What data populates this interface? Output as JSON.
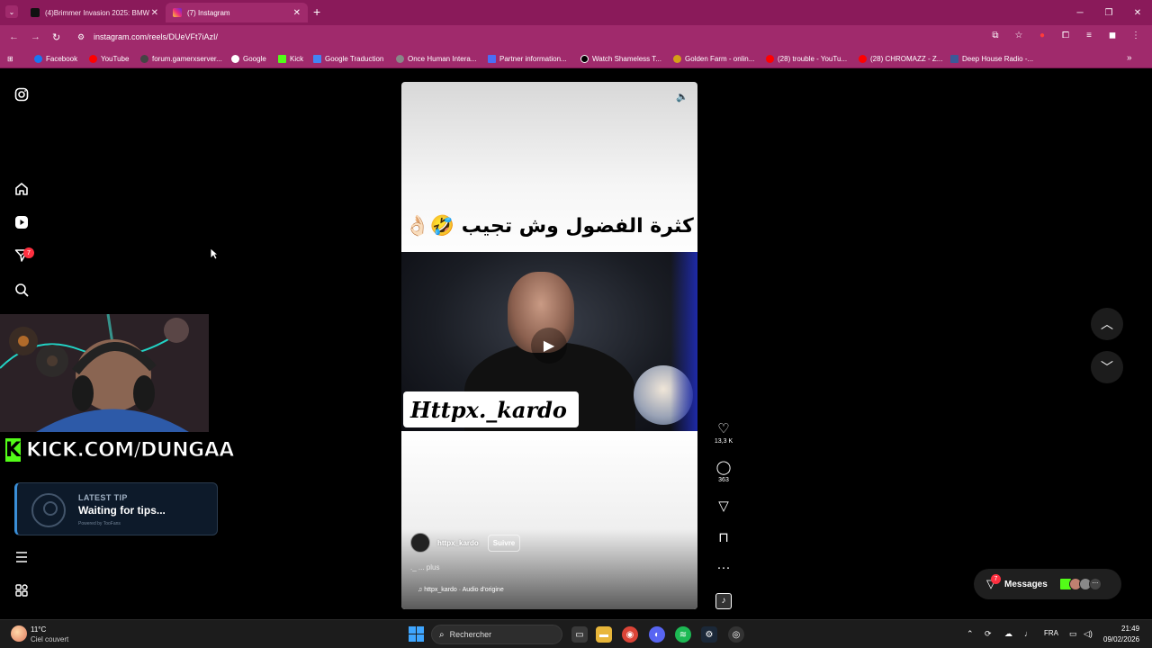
{
  "browser": {
    "tabs": [
      {
        "label": "(4)Brimmer Invasion 2025: BMW",
        "active": false
      },
      {
        "label": "(7) Instagram",
        "active": true
      }
    ],
    "url": "instagram.com/reels/DUeVFt7iAzI/",
    "bookmarks": [
      {
        "label": "Facebook",
        "color": "#1877f2"
      },
      {
        "label": "YouTube",
        "color": "#ff0000"
      },
      {
        "label": "forum.gamerxserver...",
        "color": "#444444"
      },
      {
        "label": "Google",
        "color": "#ffffff"
      },
      {
        "label": "Kick",
        "color": "#53fc18"
      },
      {
        "label": "Google Traduction",
        "color": "#4285f4"
      },
      {
        "label": "Once Human Intera...",
        "color": "#888888"
      },
      {
        "label": "Partner information...",
        "color": "#4b6ef5"
      },
      {
        "label": "Watch Shameless T...",
        "color": "#000000"
      },
      {
        "label": "Golden Farm - onlin...",
        "color": "#d4a017"
      },
      {
        "label": "(28) trouble - YouTu...",
        "color": "#ff0000"
      },
      {
        "label": "(28) CHROMAZZ - Z...",
        "color": "#ff0000"
      },
      {
        "label": "Deep House Radio -...",
        "color": "#3b5998"
      }
    ]
  },
  "sidebar": {
    "notification_count": "7"
  },
  "stream_overlay": {
    "kick_url": "KICK.COM/DUNGAA",
    "kick_logo_letter": "K",
    "tip_label": "LATEST TIP",
    "tip_text": "Waiting for tips...",
    "tip_powered": "Powered by TooFans"
  },
  "reel": {
    "caption_overlay": "كثرة الفضول وش تجيب 🤣👌🏻",
    "watermark": "Httpx._kardo",
    "author": "httpx_kardo",
    "follow_label": "Suivre",
    "caption": "._ ... plus",
    "audio": "httpx_kardo · Audio d'origine"
  },
  "actions": {
    "likes": "13,3 K",
    "comments": "363"
  },
  "messages": {
    "label": "Messages",
    "badge": "7"
  },
  "taskbar": {
    "temperature": "11°C",
    "weather": "Ciel couvert",
    "search_placeholder": "Rechercher",
    "language": "FRA",
    "time": "21:49",
    "date": "09/02/2026"
  },
  "colors": {
    "browser_accent": "#a02a6c",
    "kick_green": "#53fc18",
    "notification_red": "#ff3040"
  }
}
